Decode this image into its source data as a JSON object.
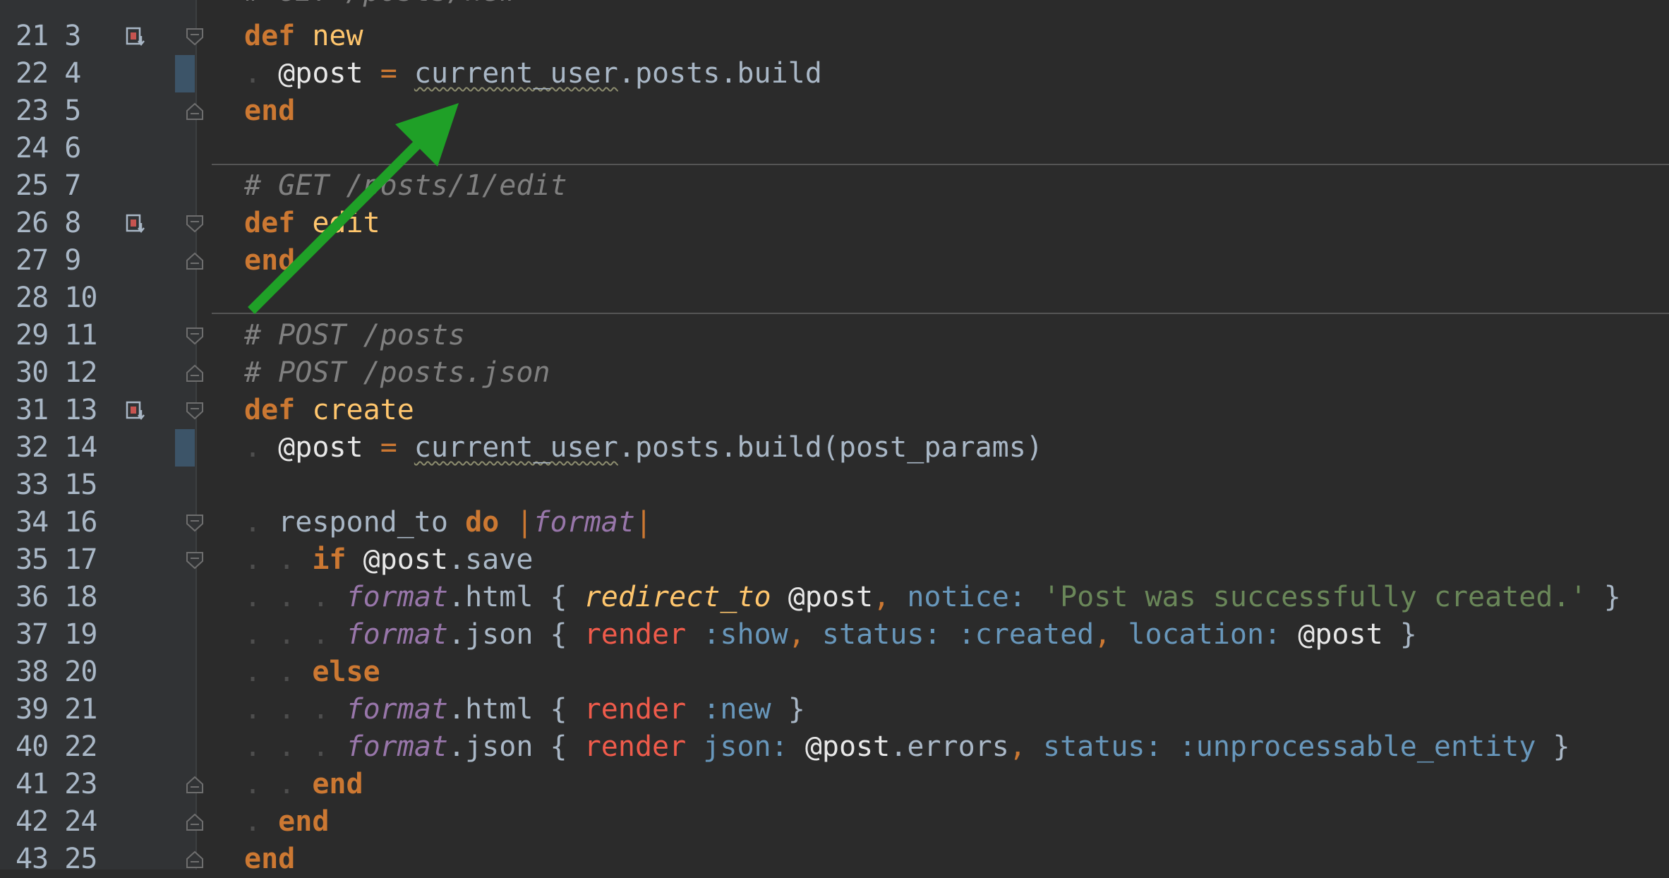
{
  "editor": {
    "language": "ruby",
    "colors": {
      "background": "#2b2b2b",
      "gutter": "#313335",
      "keyword": "#cc7832",
      "comment": "#808080",
      "string": "#6a8759",
      "symbol": "#6897bb",
      "method": "#ffc66d",
      "render": "#ef5b4b",
      "arrow": "#1fa027"
    },
    "lines": [
      {
        "num": "21 3"
      },
      {
        "num": "22 4"
      },
      {
        "num": "23 5"
      },
      {
        "num": "24 6"
      },
      {
        "num": "25 7"
      },
      {
        "num": "26 8"
      },
      {
        "num": "27 9"
      },
      {
        "num": "28 10"
      },
      {
        "num": "29 11"
      },
      {
        "num": "30 12"
      },
      {
        "num": "31 13"
      },
      {
        "num": "32 14"
      },
      {
        "num": "33 15"
      },
      {
        "num": "34 16"
      },
      {
        "num": "35 17"
      },
      {
        "num": "36 18"
      },
      {
        "num": "37 19"
      },
      {
        "num": "38 20"
      },
      {
        "num": "39 21"
      },
      {
        "num": "40 22"
      },
      {
        "num": "41 23"
      },
      {
        "num": "42 24"
      },
      {
        "num": "43 25"
      }
    ],
    "partial_top_line": "# GET /posts/new",
    "code": {
      "kw_def": "def",
      "kw_end": "end",
      "kw_do": "do",
      "kw_if": "if",
      "kw_else": "else",
      "name_new": "new",
      "name_edit": "edit",
      "name_create": "create",
      "ivar_post": "@post",
      "eq": "=",
      "current_user": "current_user",
      "posts_build": ".posts.build",
      "build_args": "(post_params)",
      "comment_edit": "# GET /posts/1/edit",
      "comment_post": "# POST /posts",
      "comment_post_json": "# POST /posts.json",
      "respond_to": "respond_to",
      "pipe": "|",
      "format": "format",
      "save": ".save",
      "html": ".html",
      "json_m": ".json",
      "lbrace": "{",
      "rbrace": "}",
      "comma": ",",
      "redirect_to": "redirect_to",
      "notice": "notice:",
      "notice_str": "'Post was successfully created.'",
      "render": "render",
      "sym_show": ":show",
      "status_key": "status:",
      "sym_created": ":created",
      "location_key": "location:",
      "sym_new": ":new",
      "json_key": "json:",
      "errors": ".errors",
      "sym_unprocessable": ":unprocessable_entity"
    }
  }
}
